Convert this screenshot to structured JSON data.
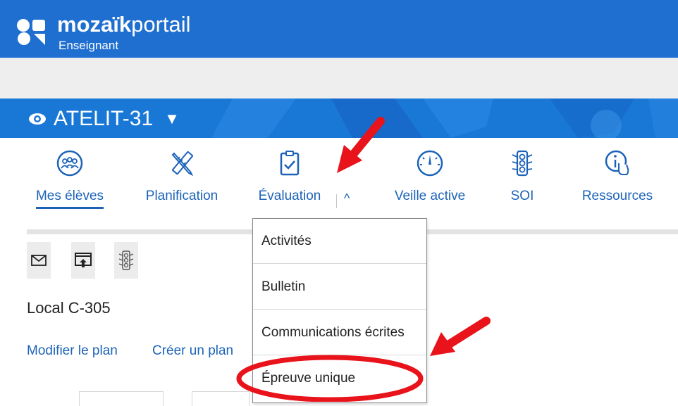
{
  "brand": {
    "name_bold": "mozaïk",
    "name_light": "portail",
    "role": "Enseignant"
  },
  "class_selector": {
    "name": "ATELIT-31",
    "caret": "▼",
    "icon": "eye-icon"
  },
  "nav": {
    "items": [
      {
        "label": "Mes élèves",
        "icon": "students-group-icon",
        "active": true
      },
      {
        "label": "Planification",
        "icon": "ruler-pencil-icon",
        "active": false
      },
      {
        "label": "Évaluation",
        "icon": "clipboard-check-icon",
        "active": false
      },
      {
        "label": "Veille active",
        "icon": "gauge-icon",
        "active": false
      },
      {
        "label": "SOI",
        "icon": "traffic-light-icon",
        "active": false
      },
      {
        "label": "Ressources",
        "icon": "info-hand-icon",
        "active": false
      }
    ],
    "evaluation_toggle": "^"
  },
  "toolbar": {
    "buttons": [
      {
        "icon": "envelope-icon"
      },
      {
        "icon": "share-screen-icon"
      },
      {
        "icon": "traffic-light-icon"
      }
    ]
  },
  "main": {
    "local": "Local C-305",
    "links": [
      "Modifier le plan",
      "Créer un plan"
    ]
  },
  "dropdown": {
    "items": [
      "Activités",
      "Bulletin",
      "Communications écrites",
      "Épreuve unique"
    ]
  },
  "colors": {
    "topbar": "#1f6fd0",
    "classbar": "#1977d6",
    "link": "#1c63b8",
    "annotation": "#e8131b"
  }
}
